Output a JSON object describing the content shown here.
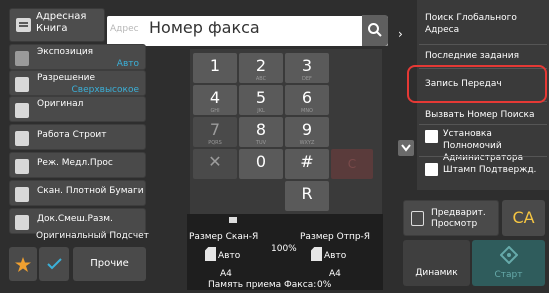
{
  "header": {
    "address_book_label": "Адресная Книга",
    "address_label": "Адрес",
    "fax_input_placeholder": "Номер факса",
    "search_icon": "search-icon"
  },
  "settings": [
    {
      "label": "Экспозиция",
      "value": "Авто"
    },
    {
      "label": "Разрешение",
      "value": "Сверхвысокое"
    },
    {
      "label": "Оригинал",
      "value": ""
    },
    {
      "label": "Работа Строит",
      "value": ""
    },
    {
      "label": "Реж. Медл.Прос",
      "value": ""
    },
    {
      "label": "Скан. Плотной Бумаги",
      "value": ""
    },
    {
      "label": "Док.Смеш.Разм.",
      "value": ""
    },
    {
      "label": "Оригинальный Подсчет",
      "value": ""
    }
  ],
  "bottom_left": {
    "other_label": "Прочие"
  },
  "keypad": {
    "keys": [
      {
        "digit": "1",
        "sub": ""
      },
      {
        "digit": "2",
        "sub": "ABC"
      },
      {
        "digit": "3",
        "sub": "DEF"
      },
      {
        "digit": "4",
        "sub": "GHI"
      },
      {
        "digit": "5",
        "sub": "JKL"
      },
      {
        "digit": "6",
        "sub": "MNO"
      },
      {
        "digit": "7",
        "sub": "PQRS"
      },
      {
        "digit": "8",
        "sub": "TUV"
      },
      {
        "digit": "9",
        "sub": "WXYZ"
      },
      {
        "digit": "✕",
        "sub": ""
      },
      {
        "digit": "0",
        "sub": ""
      },
      {
        "digit": "#",
        "sub": ""
      },
      {
        "digit": "C",
        "sub": ""
      },
      {
        "digit": "R",
        "sub": ""
      }
    ]
  },
  "status": {
    "scan_size_label": "Размер Скан-Я",
    "scale": "100%",
    "send_size_label": "Размер Отпр-Я",
    "scan_mode": "Авто",
    "send_mode": "Авто",
    "scan_paper": "A4",
    "send_paper": "A4",
    "memory_label": "Память приема Факса:",
    "memory_value": "0%"
  },
  "right_panel": {
    "global_search": "Поиск Глобального Адреса",
    "recent_jobs": "Последние задания",
    "send_log": "Запись Передач",
    "call_search": "Вызвать Номер Поиска",
    "admin_setting": "Установка Полномочий Администратора",
    "stamp": "Штамп Подтвержд.",
    "highlight_color": "#e53935"
  },
  "actions": {
    "preview_label": "Предварит. Просмотр",
    "ca_label": "CA",
    "speaker_label": "Динамик",
    "start_label": "Старт"
  }
}
